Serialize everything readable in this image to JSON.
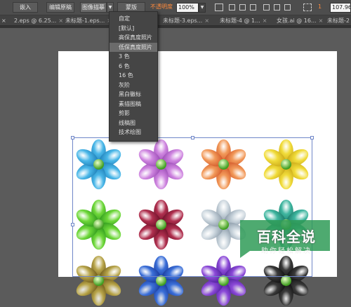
{
  "toolbar": {
    "embed_label": "嵌入",
    "edit_original_label": "编辑原稿",
    "image_trace_label": "图像描摹",
    "preset_label": "蒙版",
    "opacity_label": "不透明度",
    "opacity_value": "100%",
    "stroke_value": "1",
    "zoom_value": "107.96"
  },
  "tabs": [
    {
      "label": "2.eps @ 6.25..."
    },
    {
      "label": "未标题-1.eps..."
    },
    {
      "label": "未标题-3.eps..."
    },
    {
      "label": "未标题-4 @ 1..."
    },
    {
      "label": "女孩.ai @ 16..."
    },
    {
      "label": "未标题-2 @..."
    }
  ],
  "trace_menu": {
    "items": [
      {
        "label": "自定",
        "selected": false
      },
      {
        "label": "[默认]",
        "selected": false
      },
      {
        "label": "高保真度照片",
        "selected": false
      },
      {
        "label": "低保真度照片",
        "selected": true
      },
      {
        "label": "3 色",
        "selected": false
      },
      {
        "label": "6 色",
        "selected": false
      },
      {
        "label": "16 色",
        "selected": false
      },
      {
        "label": "灰阶",
        "selected": false
      },
      {
        "label": "黑白徽标",
        "selected": false
      },
      {
        "label": "素描图稿",
        "selected": false
      },
      {
        "label": "剪影",
        "selected": false
      },
      {
        "label": "线稿图",
        "selected": false
      },
      {
        "label": "技术绘图",
        "selected": false
      }
    ]
  },
  "flowers": [
    {
      "color": "#4ab7e8",
      "dark": "#1f7fb8"
    },
    {
      "color": "#cf86e0",
      "dark": "#9a4bb5"
    },
    {
      "color": "#f29a5a",
      "dark": "#d2582a"
    },
    {
      "color": "#f1dc3a",
      "dark": "#c9a818"
    },
    {
      "color": "#6fd83a",
      "dark": "#2f9a1e"
    },
    {
      "color": "#b0304f",
      "dark": "#6c1028"
    },
    {
      "color": "#c9d4dc",
      "dark": "#8a9aa8"
    },
    {
      "color": "#3fb6a0",
      "dark": "#1b7a68"
    },
    {
      "color": "#b8a54a",
      "dark": "#6e5a1a"
    },
    {
      "color": "#3b6fd8",
      "dark": "#1a3a9a"
    },
    {
      "color": "#8c4ad8",
      "dark": "#4e1f9a"
    },
    {
      "color": "#3a3a3a",
      "dark": "#111111"
    }
  ],
  "watermark": {
    "title": "百科全说",
    "subtitle": "助你轻松解决"
  }
}
